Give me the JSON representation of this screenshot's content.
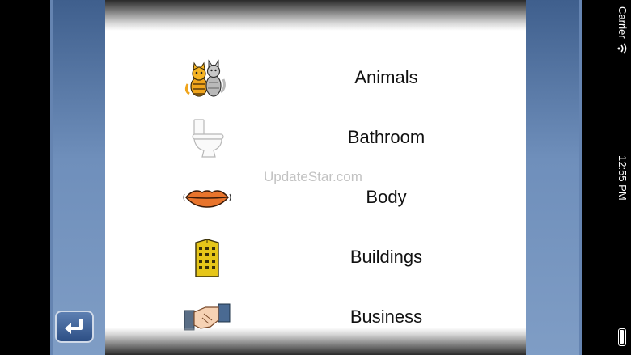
{
  "categories": [
    {
      "label": "Animals",
      "icon": "cat-icon"
    },
    {
      "label": "Bathroom",
      "icon": "toilet-icon"
    },
    {
      "label": "Body",
      "icon": "lips-icon"
    },
    {
      "label": "Buildings",
      "icon": "building-icon"
    },
    {
      "label": "Business",
      "icon": "handshake-icon"
    }
  ],
  "watermark": "UpdateStar.com",
  "status_bar": {
    "carrier": "Carrier",
    "time": "12:55 PM"
  }
}
